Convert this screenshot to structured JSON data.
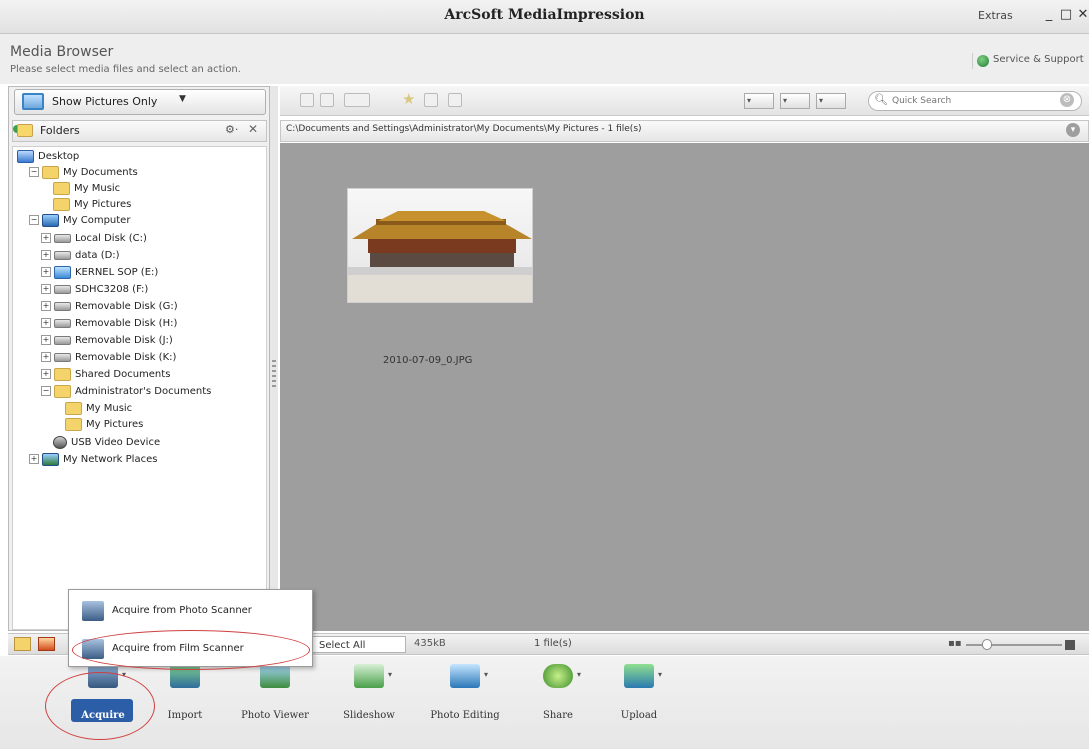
{
  "window": {
    "title": "ArcSoft MediaImpression",
    "extras": "Extras",
    "minimize": "_",
    "maximize": "□",
    "close": "✕"
  },
  "header": {
    "title": "Media Browser",
    "subtitle": "Please select media files and select an action.",
    "service_label": "Service & Support"
  },
  "sidebar": {
    "filter_label": "Show Pictures Only",
    "filter_caret": "▼",
    "folders_label": "Folders",
    "gear": "⚙·",
    "close": "✕",
    "tree": [
      {
        "label": "Desktop",
        "icon": "desktop-icon",
        "indent": 0,
        "exp": ""
      },
      {
        "label": "My Documents",
        "icon": "folder-icon",
        "indent": 1,
        "exp": "−"
      },
      {
        "label": "My Music",
        "icon": "folder-icon",
        "indent": 3,
        "exp": ""
      },
      {
        "label": "My Pictures",
        "icon": "folder-icon",
        "indent": 3,
        "exp": ""
      },
      {
        "label": "My Computer",
        "icon": "computer-icon",
        "indent": 1,
        "exp": "−"
      },
      {
        "label": "Local Disk (C:)",
        "icon": "drive-icon",
        "indent": 2,
        "exp": "+"
      },
      {
        "label": "data (D:)",
        "icon": "drive-icon",
        "indent": 2,
        "exp": "+"
      },
      {
        "label": "KERNEL SOP (E:)",
        "icon": "sd-icon",
        "indent": 2,
        "exp": "+"
      },
      {
        "label": "SDHC3208 (F:)",
        "icon": "drive-icon",
        "indent": 2,
        "exp": "+"
      },
      {
        "label": "Removable Disk (G:)",
        "icon": "drive-icon",
        "indent": 2,
        "exp": "+"
      },
      {
        "label": "Removable Disk (H:)",
        "icon": "drive-icon",
        "indent": 2,
        "exp": "+"
      },
      {
        "label": "Removable Disk (J:)",
        "icon": "drive-icon",
        "indent": 2,
        "exp": "+"
      },
      {
        "label": "Removable Disk (K:)",
        "icon": "drive-icon",
        "indent": 2,
        "exp": "+"
      },
      {
        "label": "Shared Documents",
        "icon": "folder-icon",
        "indent": 2,
        "exp": "+"
      },
      {
        "label": "Administrator's Documents",
        "icon": "folder-icon",
        "indent": 2,
        "exp": "−"
      },
      {
        "label": "My Music",
        "icon": "folder-icon",
        "indent": 4,
        "exp": ""
      },
      {
        "label": "My Pictures",
        "icon": "folder-icon",
        "indent": 4,
        "exp": ""
      },
      {
        "label": "USB Video Device",
        "icon": "usb-icon",
        "indent": 3,
        "exp": ""
      },
      {
        "label": "My Network Places",
        "icon": "network-icon",
        "indent": 1,
        "exp": "+"
      }
    ]
  },
  "toolbar": {
    "star": "★",
    "view_caret": "▾",
    "search_placeholder": "Quick Search",
    "search_clear": "⊗"
  },
  "path": {
    "text": "C:\\Documents and Settings\\Administrator\\My Documents\\My Pictures - 1 file(s)",
    "menu_glyph": "▾"
  },
  "content": {
    "file_name": "2010-07-09_0.JPG"
  },
  "statusbar": {
    "select_all": "Select All",
    "size": "435kB",
    "count": "1 file(s)",
    "grid_glyph": "▪▪"
  },
  "popup": {
    "items": [
      {
        "label": "Acquire from Photo Scanner"
      },
      {
        "label": "Acquire from Film Scanner"
      }
    ]
  },
  "actions": [
    {
      "label": "Acquire"
    },
    {
      "label": "Import"
    },
    {
      "label": "Photo Viewer"
    },
    {
      "label": "Slideshow"
    },
    {
      "label": "Photo Editing"
    },
    {
      "label": "Share"
    },
    {
      "label": "Upload"
    }
  ]
}
